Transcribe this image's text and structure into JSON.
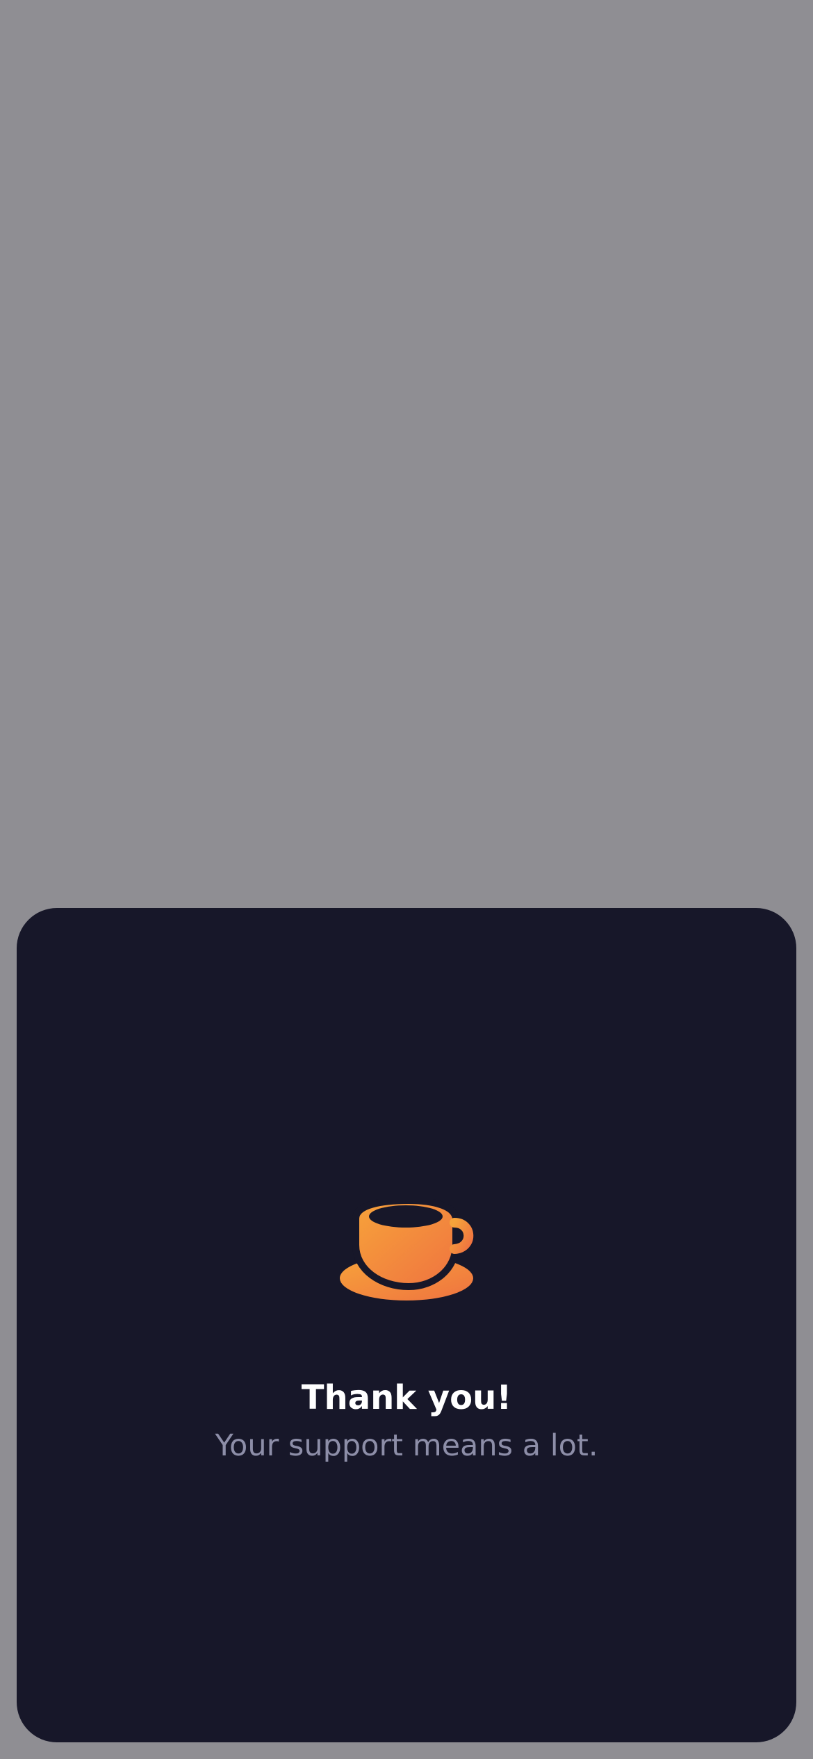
{
  "sheet": {
    "icon_name": "coffee-cup-icon",
    "title": "Thank you!",
    "subtitle": "Your support means a lot."
  },
  "colors": {
    "backdrop": "#8f8e93",
    "sheet_background": "#171729",
    "accent_start": "#f7a33a",
    "accent_end": "#ef7340",
    "title_text": "#ffffff",
    "subtitle_text": "#8d8ea8"
  }
}
